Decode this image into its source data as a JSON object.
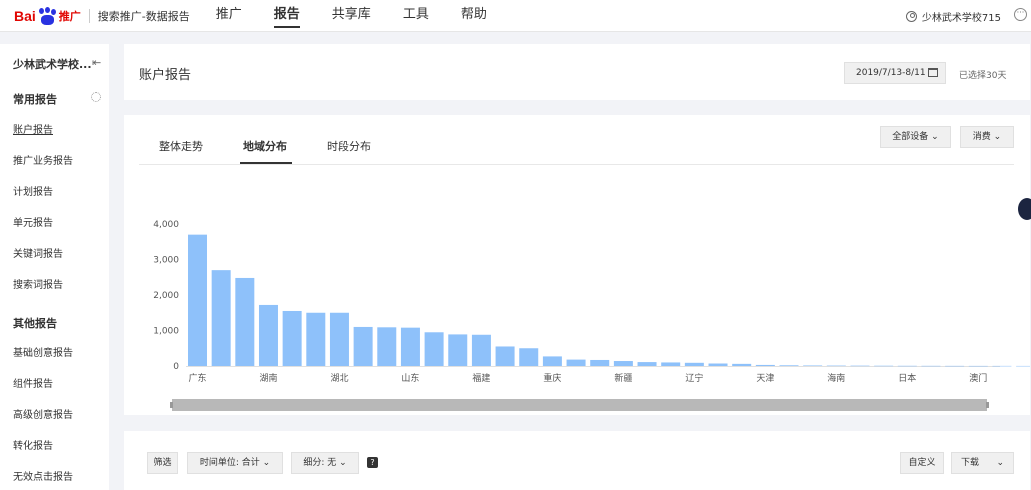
{
  "header": {
    "logo_bai": "Bai",
    "logo_tui": "推广",
    "subtitle": "搜索推广-数据报告",
    "nav": [
      {
        "label": "推广",
        "active": false
      },
      {
        "label": "报告",
        "active": true
      },
      {
        "label": "共享库",
        "active": false
      },
      {
        "label": "工具",
        "active": false
      },
      {
        "label": "帮助",
        "active": false
      }
    ],
    "user": "少林武术学校715",
    "more": "···"
  },
  "sidebar": {
    "account": "少林武术学校...",
    "collapse": "⇤",
    "group1": "常用报告",
    "group2": "其他报告",
    "common": [
      "账户报告",
      "推广业务报告",
      "计划报告",
      "单元报告",
      "关键词报告",
      "搜索词报告"
    ],
    "other": [
      "基础创意报告",
      "组件报告",
      "高级创意报告",
      "转化报告",
      "无效点击报告"
    ]
  },
  "main": {
    "title": "账户报告",
    "date_range": "2019/7/13-8/11",
    "selected_days": "已选择30天",
    "tabs": [
      "整体走势",
      "地域分布",
      "时段分布"
    ],
    "device_select": "全部设备",
    "metric_select": "消费",
    "filters": {
      "filter": "筛选",
      "time_unit": "时间单位: 合计",
      "breakdown": "细分: 无",
      "custom": "自定义",
      "download": "下载"
    }
  },
  "colors": {
    "bar": "#8ec1fa",
    "axis": "#e0e0e0",
    "brand_red": "#e10602",
    "brand_blue": "#2932e1"
  },
  "chart_data": {
    "type": "bar",
    "categories": [
      "广东",
      "",
      "湖南",
      "",
      "湖北",
      "",
      "山东",
      "",
      "福建",
      "",
      "重庆",
      "",
      "新疆",
      "",
      "辽宁",
      "",
      "天津",
      "",
      "海南",
      "",
      "日本",
      "",
      "澳门",
      ""
    ],
    "x_tick_labels": [
      "广东",
      "湖南",
      "湖北",
      "山东",
      "福建",
      "重庆",
      "新疆",
      "辽宁",
      "天津",
      "海南",
      "日本",
      "澳门"
    ],
    "values": [
      3700,
      2700,
      2480,
      1720,
      1550,
      1500,
      1500,
      1100,
      1090,
      1080,
      950,
      890,
      880,
      550,
      500,
      270,
      180,
      170,
      140,
      110,
      100,
      90,
      70,
      60,
      30,
      20,
      15,
      12,
      10,
      8,
      6,
      5,
      4,
      3,
      3,
      2
    ],
    "y_ticks": [
      "0",
      "1,000",
      "2,000",
      "3,000",
      "4,000"
    ],
    "ylim": [
      0,
      4000
    ]
  }
}
